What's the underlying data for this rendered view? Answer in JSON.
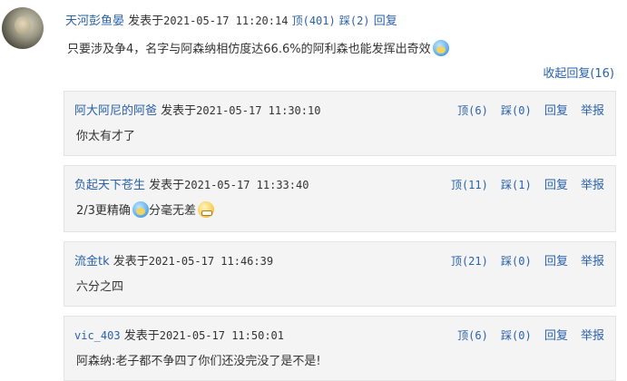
{
  "main": {
    "author": "天河彭鱼晏",
    "posted_label": "发表于",
    "timestamp": "2021-05-17 11:20:14",
    "up_label": "顶(401)",
    "down_label": "踩(2)",
    "reply_label": "回复",
    "content": "只要涉及争4，名字与阿森纳相仿度达66.6%的阿利森也能发挥出奇效",
    "content_emoji": "blue-face-icon",
    "collapse_label": "收起回复(16)"
  },
  "replies": [
    {
      "author": "阿大阿尼的阿爸",
      "posted_label": "发表于",
      "timestamp": "2021-05-17 11:30:10",
      "up": "顶(6)",
      "down": "踩(0)",
      "reply": "回复",
      "report": "举报",
      "text": "你太有才了"
    },
    {
      "author": "负起天下苍生",
      "posted_label": "发表于",
      "timestamp": "2021-05-17 11:33:40",
      "up": "顶(11)",
      "down": "踩(1)",
      "reply": "回复",
      "report": "举报",
      "text_a": "2/3更精确",
      "text_b": "分毫无差"
    },
    {
      "author": "流金tk",
      "posted_label": "发表于",
      "timestamp": "2021-05-17 11:46:39",
      "up": "顶(21)",
      "down": "踩(0)",
      "reply": "回复",
      "report": "举报",
      "text": "六分之四"
    },
    {
      "author": "vic_403",
      "posted_label": "发表于",
      "timestamp": "2021-05-17 11:50:01",
      "up": "顶(6)",
      "down": "踩(0)",
      "reply": "回复",
      "report": "举报",
      "text": "阿森纳:老子都不争四了你们还没完没了是不是!"
    }
  ]
}
